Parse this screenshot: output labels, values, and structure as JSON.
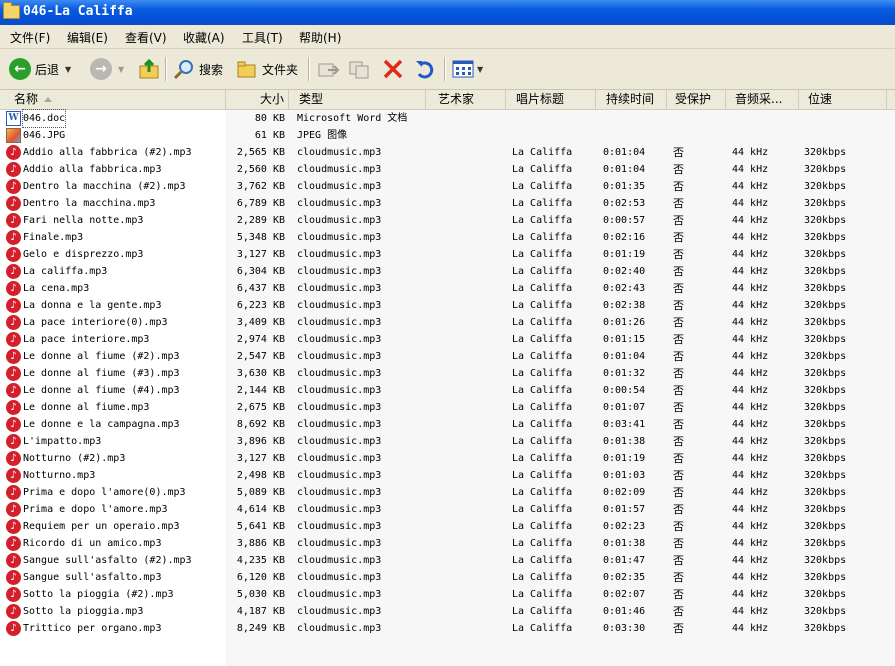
{
  "window": {
    "title": "046-La Califfa"
  },
  "menu": [
    "文件(F)",
    "编辑(E)",
    "查看(V)",
    "收藏(A)",
    "工具(T)",
    "帮助(H)"
  ],
  "toolbar": {
    "back": "后退",
    "search": "搜索",
    "folders": "文件夹"
  },
  "columns": {
    "name": "名称",
    "size": "大小",
    "type": "类型",
    "artist": "艺术家",
    "album": "唱片标题",
    "duration": "持续时间",
    "protected": "受保护",
    "sample_rate": "音频采...",
    "bitrate": "位速"
  },
  "files": [
    {
      "icon": "word-doc-icon",
      "name": "046.doc",
      "size": "80 KB",
      "type": "Microsoft Word 文档",
      "album": "",
      "duration": "",
      "protected": "",
      "rate": "",
      "bitrate": ""
    },
    {
      "icon": "jpg-image-icon",
      "name": "046.JPG",
      "size": "61 KB",
      "type": "JPEG 图像",
      "album": "",
      "duration": "",
      "protected": "",
      "rate": "",
      "bitrate": ""
    },
    {
      "icon": "mp3-icon",
      "name": "Addio alla fabbrica (#2).mp3",
      "size": "2,565 KB",
      "type": "cloudmusic.mp3",
      "album": "La Califfa",
      "duration": "0:01:04",
      "protected": "否",
      "rate": "44 kHz",
      "bitrate": "320kbps"
    },
    {
      "icon": "mp3-icon",
      "name": "Addio alla fabbrica.mp3",
      "size": "2,560 KB",
      "type": "cloudmusic.mp3",
      "album": "La Califfa",
      "duration": "0:01:04",
      "protected": "否",
      "rate": "44 kHz",
      "bitrate": "320kbps"
    },
    {
      "icon": "mp3-icon",
      "name": "Dentro la macchina (#2).mp3",
      "size": "3,762 KB",
      "type": "cloudmusic.mp3",
      "album": "La Califfa",
      "duration": "0:01:35",
      "protected": "否",
      "rate": "44 kHz",
      "bitrate": "320kbps"
    },
    {
      "icon": "mp3-icon",
      "name": "Dentro la macchina.mp3",
      "size": "6,789 KB",
      "type": "cloudmusic.mp3",
      "album": "La Califfa",
      "duration": "0:02:53",
      "protected": "否",
      "rate": "44 kHz",
      "bitrate": "320kbps"
    },
    {
      "icon": "mp3-icon",
      "name": "Fari nella notte.mp3",
      "size": "2,289 KB",
      "type": "cloudmusic.mp3",
      "album": "La Califfa",
      "duration": "0:00:57",
      "protected": "否",
      "rate": "44 kHz",
      "bitrate": "320kbps"
    },
    {
      "icon": "mp3-icon",
      "name": "Finale.mp3",
      "size": "5,348 KB",
      "type": "cloudmusic.mp3",
      "album": "La Califfa",
      "duration": "0:02:16",
      "protected": "否",
      "rate": "44 kHz",
      "bitrate": "320kbps"
    },
    {
      "icon": "mp3-icon",
      "name": "Gelo e disprezzo.mp3",
      "size": "3,127 KB",
      "type": "cloudmusic.mp3",
      "album": "La Califfa",
      "duration": "0:01:19",
      "protected": "否",
      "rate": "44 kHz",
      "bitrate": "320kbps"
    },
    {
      "icon": "mp3-icon",
      "name": "La califfa.mp3",
      "size": "6,304 KB",
      "type": "cloudmusic.mp3",
      "album": "La Califfa",
      "duration": "0:02:40",
      "protected": "否",
      "rate": "44 kHz",
      "bitrate": "320kbps"
    },
    {
      "icon": "mp3-icon",
      "name": "La cena.mp3",
      "size": "6,437 KB",
      "type": "cloudmusic.mp3",
      "album": "La Califfa",
      "duration": "0:02:43",
      "protected": "否",
      "rate": "44 kHz",
      "bitrate": "320kbps"
    },
    {
      "icon": "mp3-icon",
      "name": "La donna e la gente.mp3",
      "size": "6,223 KB",
      "type": "cloudmusic.mp3",
      "album": "La Califfa",
      "duration": "0:02:38",
      "protected": "否",
      "rate": "44 kHz",
      "bitrate": "320kbps"
    },
    {
      "icon": "mp3-icon",
      "name": "La pace interiore(0).mp3",
      "size": "3,409 KB",
      "type": "cloudmusic.mp3",
      "album": "La Califfa",
      "duration": "0:01:26",
      "protected": "否",
      "rate": "44 kHz",
      "bitrate": "320kbps"
    },
    {
      "icon": "mp3-icon",
      "name": "La pace interiore.mp3",
      "size": "2,974 KB",
      "type": "cloudmusic.mp3",
      "album": "La Califfa",
      "duration": "0:01:15",
      "protected": "否",
      "rate": "44 kHz",
      "bitrate": "320kbps"
    },
    {
      "icon": "mp3-icon",
      "name": "Le donne al fiume (#2).mp3",
      "size": "2,547 KB",
      "type": "cloudmusic.mp3",
      "album": "La Califfa",
      "duration": "0:01:04",
      "protected": "否",
      "rate": "44 kHz",
      "bitrate": "320kbps"
    },
    {
      "icon": "mp3-icon",
      "name": "Le donne al fiume (#3).mp3",
      "size": "3,630 KB",
      "type": "cloudmusic.mp3",
      "album": "La Califfa",
      "duration": "0:01:32",
      "protected": "否",
      "rate": "44 kHz",
      "bitrate": "320kbps"
    },
    {
      "icon": "mp3-icon",
      "name": "Le donne al fiume (#4).mp3",
      "size": "2,144 KB",
      "type": "cloudmusic.mp3",
      "album": "La Califfa",
      "duration": "0:00:54",
      "protected": "否",
      "rate": "44 kHz",
      "bitrate": "320kbps"
    },
    {
      "icon": "mp3-icon",
      "name": "Le donne al fiume.mp3",
      "size": "2,675 KB",
      "type": "cloudmusic.mp3",
      "album": "La Califfa",
      "duration": "0:01:07",
      "protected": "否",
      "rate": "44 kHz",
      "bitrate": "320kbps"
    },
    {
      "icon": "mp3-icon",
      "name": "Le donne e la campagna.mp3",
      "size": "8,692 KB",
      "type": "cloudmusic.mp3",
      "album": "La Califfa",
      "duration": "0:03:41",
      "protected": "否",
      "rate": "44 kHz",
      "bitrate": "320kbps"
    },
    {
      "icon": "mp3-icon",
      "name": "L'impatto.mp3",
      "size": "3,896 KB",
      "type": "cloudmusic.mp3",
      "album": "La Califfa",
      "duration": "0:01:38",
      "protected": "否",
      "rate": "44 kHz",
      "bitrate": "320kbps"
    },
    {
      "icon": "mp3-icon",
      "name": "Notturno (#2).mp3",
      "size": "3,127 KB",
      "type": "cloudmusic.mp3",
      "album": "La Califfa",
      "duration": "0:01:19",
      "protected": "否",
      "rate": "44 kHz",
      "bitrate": "320kbps"
    },
    {
      "icon": "mp3-icon",
      "name": "Notturno.mp3",
      "size": "2,498 KB",
      "type": "cloudmusic.mp3",
      "album": "La Califfa",
      "duration": "0:01:03",
      "protected": "否",
      "rate": "44 kHz",
      "bitrate": "320kbps"
    },
    {
      "icon": "mp3-icon",
      "name": "Prima e dopo l'amore(0).mp3",
      "size": "5,089 KB",
      "type": "cloudmusic.mp3",
      "album": "La Califfa",
      "duration": "0:02:09",
      "protected": "否",
      "rate": "44 kHz",
      "bitrate": "320kbps"
    },
    {
      "icon": "mp3-icon",
      "name": "Prima e dopo l'amore.mp3",
      "size": "4,614 KB",
      "type": "cloudmusic.mp3",
      "album": "La Califfa",
      "duration": "0:01:57",
      "protected": "否",
      "rate": "44 kHz",
      "bitrate": "320kbps"
    },
    {
      "icon": "mp3-icon",
      "name": "Requiem per un operaio.mp3",
      "size": "5,641 KB",
      "type": "cloudmusic.mp3",
      "album": "La Califfa",
      "duration": "0:02:23",
      "protected": "否",
      "rate": "44 kHz",
      "bitrate": "320kbps"
    },
    {
      "icon": "mp3-icon",
      "name": "Ricordo di un amico.mp3",
      "size": "3,886 KB",
      "type": "cloudmusic.mp3",
      "album": "La Califfa",
      "duration": "0:01:38",
      "protected": "否",
      "rate": "44 kHz",
      "bitrate": "320kbps"
    },
    {
      "icon": "mp3-icon",
      "name": "Sangue sull'asfalto (#2).mp3",
      "size": "4,235 KB",
      "type": "cloudmusic.mp3",
      "album": "La Califfa",
      "duration": "0:01:47",
      "protected": "否",
      "rate": "44 kHz",
      "bitrate": "320kbps"
    },
    {
      "icon": "mp3-icon",
      "name": "Sangue sull'asfalto.mp3",
      "size": "6,120 KB",
      "type": "cloudmusic.mp3",
      "album": "La Califfa",
      "duration": "0:02:35",
      "protected": "否",
      "rate": "44 kHz",
      "bitrate": "320kbps"
    },
    {
      "icon": "mp3-icon",
      "name": "Sotto la pioggia (#2).mp3",
      "size": "5,030 KB",
      "type": "cloudmusic.mp3",
      "album": "La Califfa",
      "duration": "0:02:07",
      "protected": "否",
      "rate": "44 kHz",
      "bitrate": "320kbps"
    },
    {
      "icon": "mp3-icon",
      "name": "Sotto la pioggia.mp3",
      "size": "4,187 KB",
      "type": "cloudmusic.mp3",
      "album": "La Califfa",
      "duration": "0:01:46",
      "protected": "否",
      "rate": "44 kHz",
      "bitrate": "320kbps"
    },
    {
      "icon": "mp3-icon",
      "name": "Trittico per organo.mp3",
      "size": "8,249 KB",
      "type": "cloudmusic.mp3",
      "album": "La Califfa",
      "duration": "0:03:30",
      "protected": "否",
      "rate": "44 kHz",
      "bitrate": "320kbps"
    }
  ]
}
